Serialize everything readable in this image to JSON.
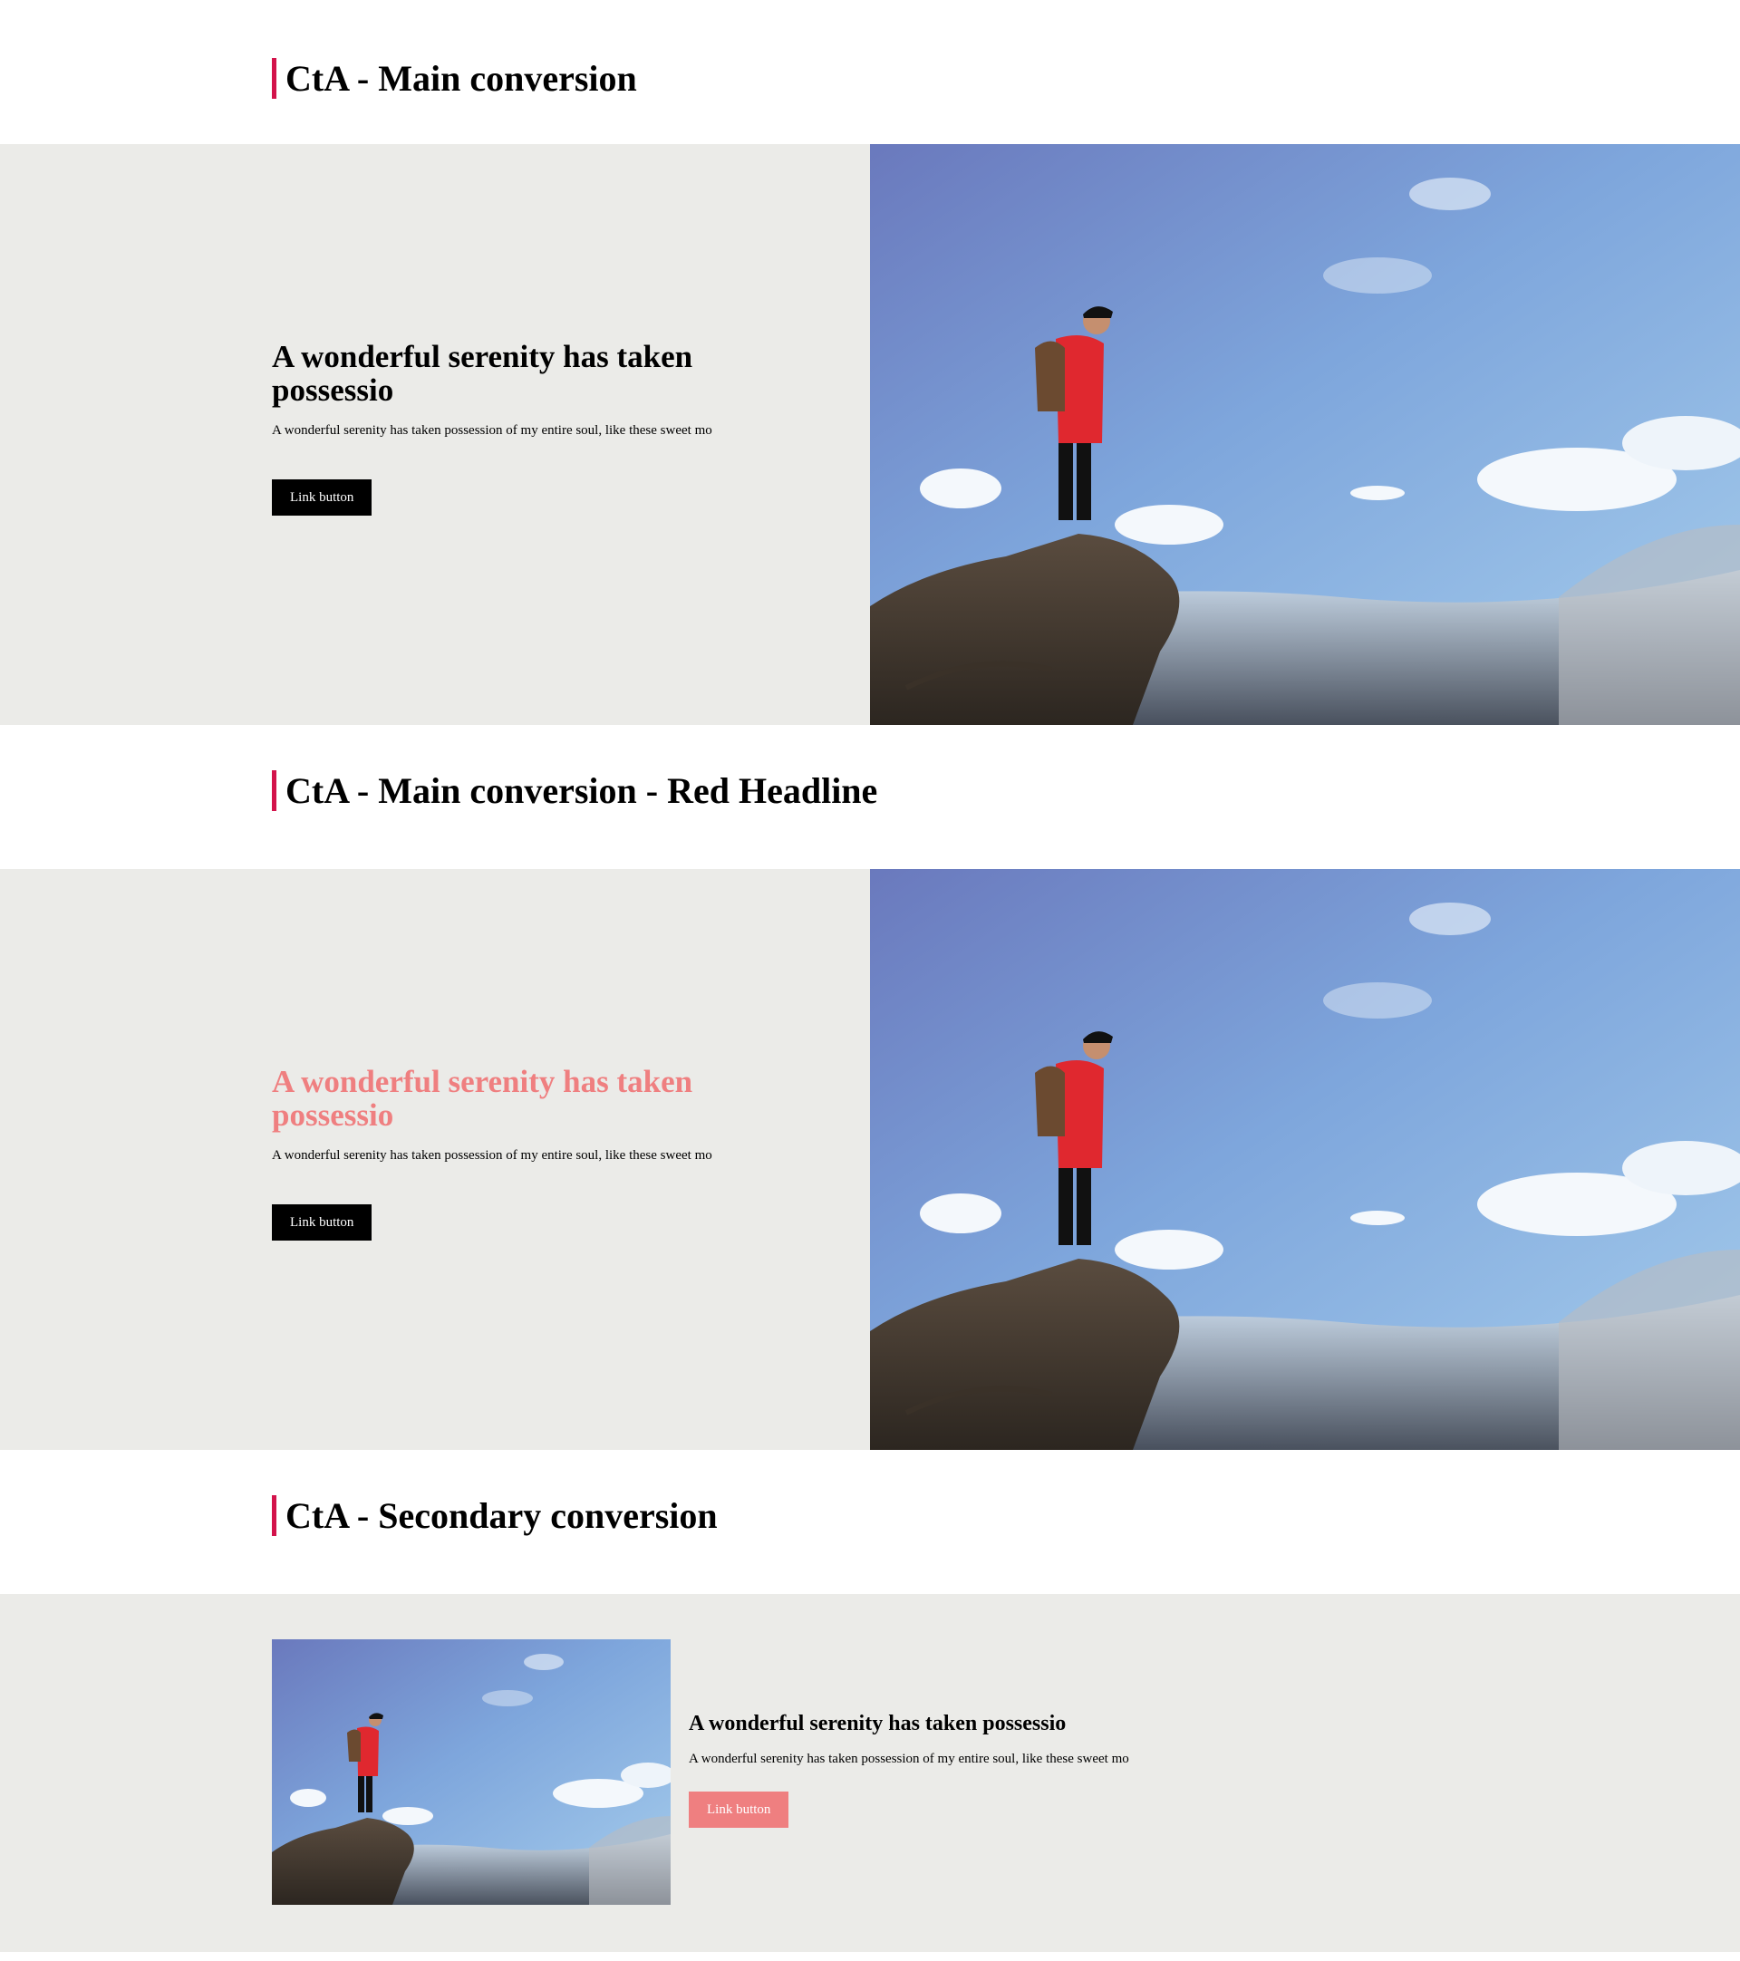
{
  "sections": [
    {
      "title": "CtA - Main conversion",
      "headline": "A wonderful serenity has taken possessio",
      "body": "A wonderful serenity has taken possession of my entire soul, like these sweet mo",
      "button_label": "Link button"
    },
    {
      "title": "CtA - Main conversion - Red Headline",
      "headline": "A wonderful serenity has taken possessio",
      "body": "A wonderful serenity has taken possession of my entire soul, like these sweet mo",
      "button_label": "Link button"
    },
    {
      "title": "CtA - Secondary conversion",
      "headline": "A wonderful serenity has taken possessio",
      "body": "A wonderful serenity has taken possession of my entire soul, like these sweet mo",
      "button_label": "Link button"
    }
  ],
  "colors": {
    "accent_bar": "#d3134b",
    "panel_bg": "#ebebe8",
    "red_headline": "#ef7f80",
    "button_primary": "#000000",
    "button_secondary": "#ef7f80"
  }
}
